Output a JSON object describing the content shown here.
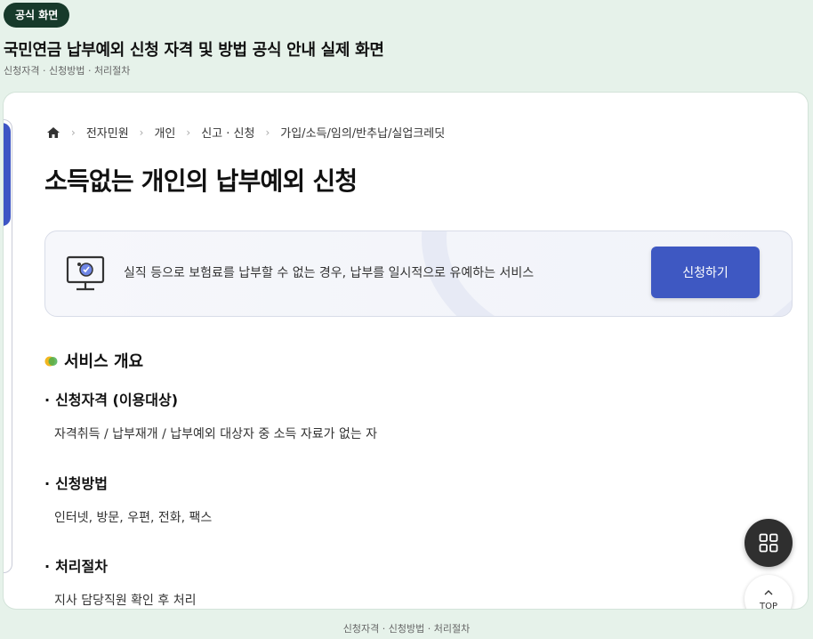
{
  "header": {
    "badge": "공식 화면",
    "title": "국민연금 납부예외 신청 자격 및 방법 공식 안내 실제 화면",
    "subtitle": "신청자격 · 신청방법 · 처리절차"
  },
  "breadcrumb": {
    "home_icon": "home-icon",
    "items": [
      "전자민원",
      "개인",
      "신고 · 신청",
      "가입/소득/임의/반추납/실업크레딧"
    ]
  },
  "main": {
    "title": "소득없는 개인의 납부예외 신청",
    "service": {
      "icon": "monitor-icon",
      "description": "실직 등으로 보험료를 납부할 수 없는 경우, 납부를 일시적으로 유예하는 서비스",
      "apply_label": "신청하기"
    },
    "overview": {
      "heading": "서비스 개요",
      "items": [
        {
          "bullet": "·",
          "title": "신청자격 (이용대상)",
          "text": "자격취득 / 납부재개 / 납부예외 대상자 중 소득 자료가 없는 자"
        },
        {
          "bullet": "·",
          "title": "신청방법",
          "text": "인터넷, 방문, 우편, 전화, 팩스"
        },
        {
          "bullet": "·",
          "title": "처리절차",
          "text": "지사 담당직원 확인 후 처리"
        }
      ]
    }
  },
  "fab": {
    "menu_icon": "grid-icon",
    "top_label": "TOP"
  },
  "footer": {
    "crumbs": "신청자격 · 신청방법 · 처리절차"
  },
  "colors": {
    "background": "#e6f2ea",
    "badge": "#173a2b",
    "accent": "#3e58c2"
  }
}
